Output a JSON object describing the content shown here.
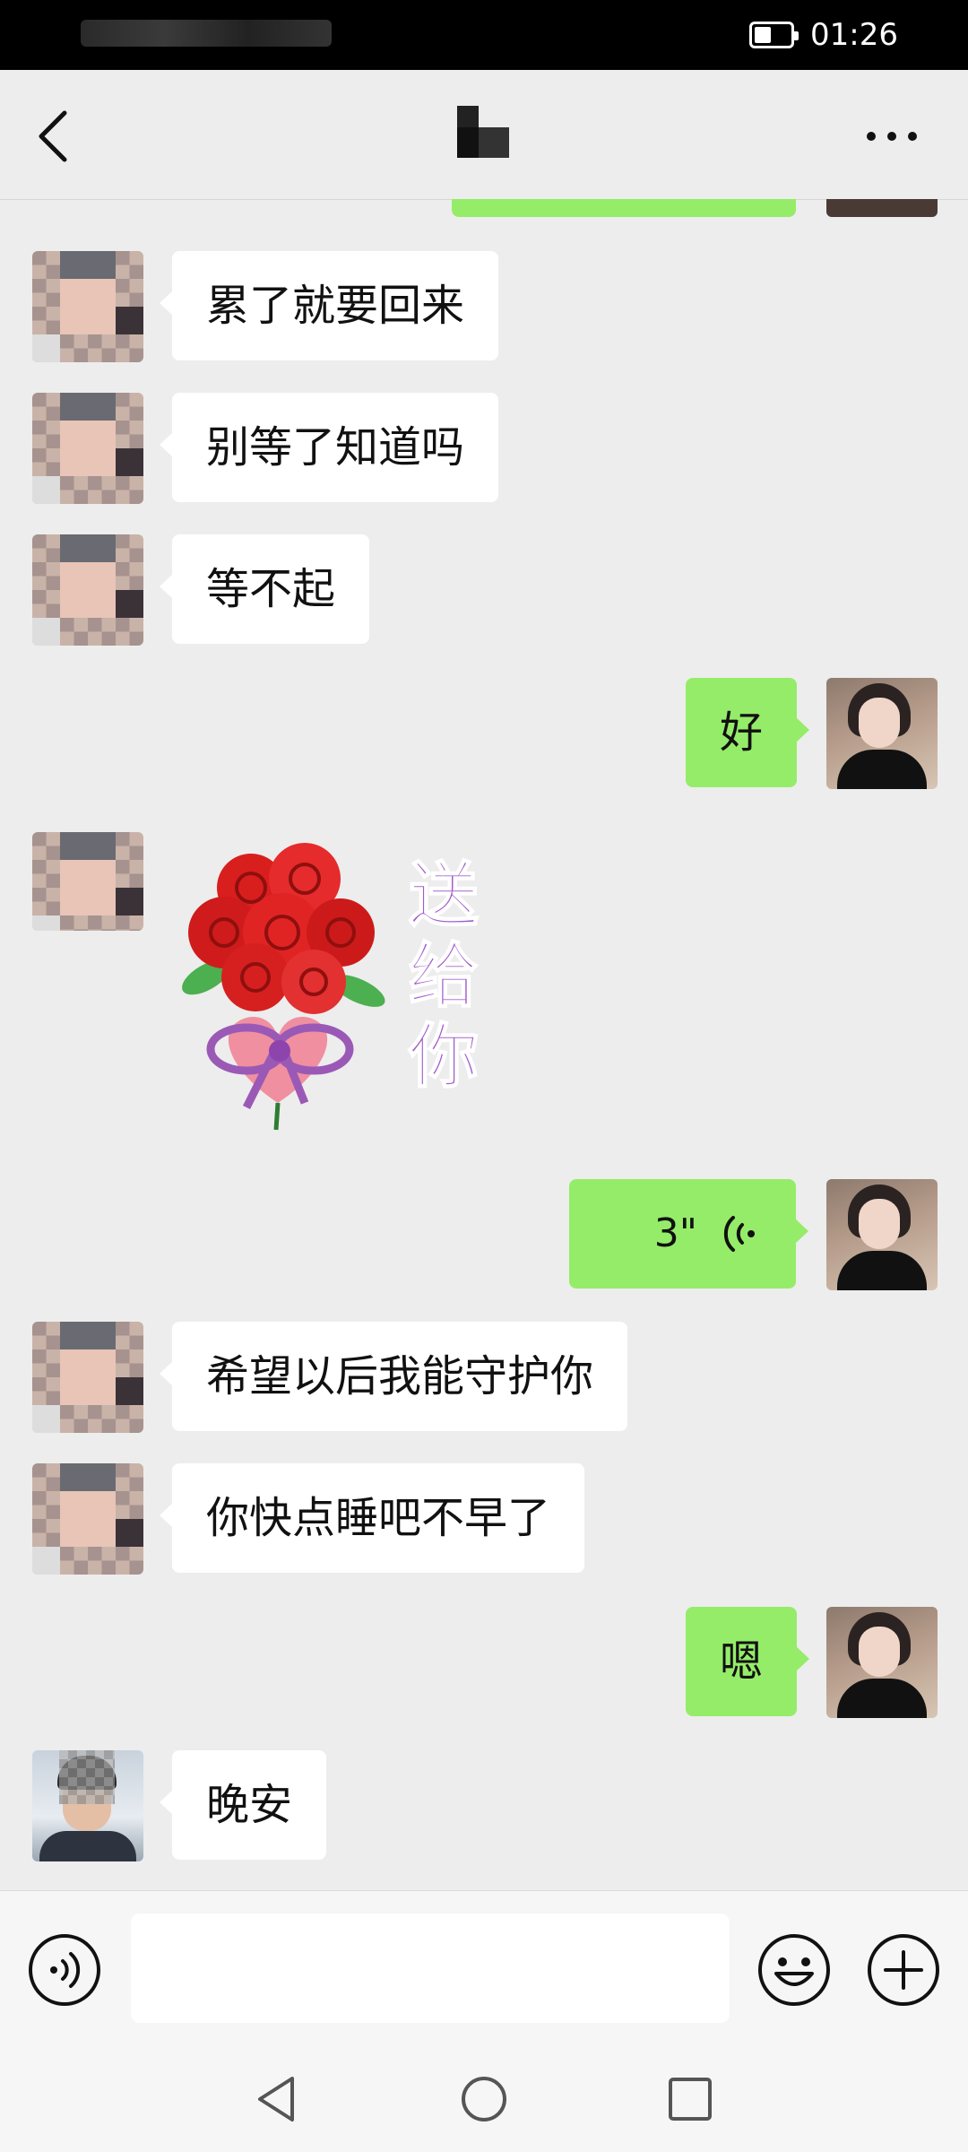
{
  "status_bar": {
    "time": "01:26"
  },
  "chat": {
    "messages": [
      {
        "side": "left",
        "type": "text",
        "text": "累了就要回来"
      },
      {
        "side": "left",
        "type": "text",
        "text": "别等了知道吗"
      },
      {
        "side": "left",
        "type": "text",
        "text": "等不起"
      },
      {
        "side": "right",
        "type": "text",
        "text": "好"
      },
      {
        "side": "left",
        "type": "sticker",
        "text": "送给你"
      },
      {
        "side": "right",
        "type": "voice",
        "text": "3\""
      },
      {
        "side": "left",
        "type": "text",
        "text": "希望以后我能守护你"
      },
      {
        "side": "left",
        "type": "text",
        "text": "你快点睡吧不早了"
      },
      {
        "side": "right",
        "type": "text",
        "text": "嗯"
      },
      {
        "side": "left",
        "type": "text",
        "text": "晚安"
      }
    ]
  },
  "input": {
    "value": ""
  },
  "colors": {
    "outgoing_bubble": "#95ec69",
    "incoming_bubble": "#ffffff",
    "background": "#ededed"
  }
}
